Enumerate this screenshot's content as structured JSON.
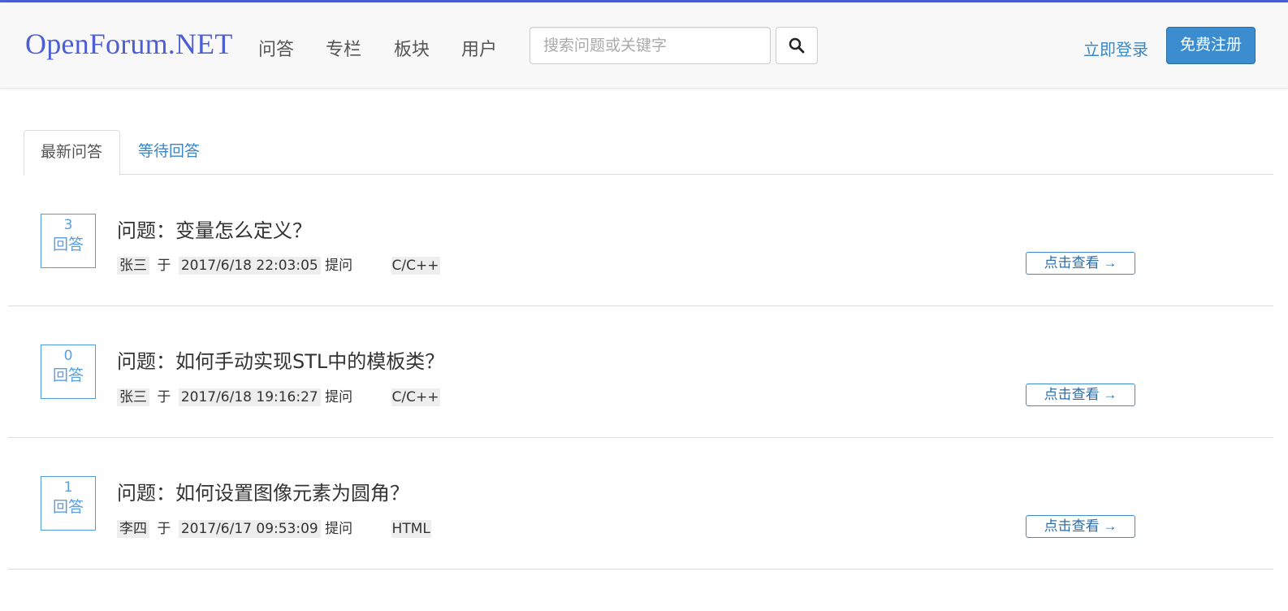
{
  "header": {
    "brand": "OpenForum.NET",
    "nav": [
      "问答",
      "专栏",
      "板块",
      "用户"
    ],
    "search": {
      "placeholder": "搜索问题或关键字",
      "value": ""
    },
    "login_label": "立即登录",
    "register_label": "免费注册"
  },
  "tabs": [
    {
      "label": "最新问答",
      "active": true
    },
    {
      "label": "等待回答",
      "active": false
    }
  ],
  "questions": [
    {
      "answer_count": "3",
      "answer_label": "回答",
      "title": "问题：变量怎么定义？",
      "author": "张三",
      "at_word": "于",
      "time": "2017/6/18 22:03:05",
      "action": "提问",
      "tag": "C/C++",
      "view_label": "点击查看 →"
    },
    {
      "answer_count": "0",
      "answer_label": "回答",
      "title": "问题：如何手动实现STL中的模板类？",
      "author": "张三",
      "at_word": "于",
      "time": "2017/6/18 19:16:27",
      "action": "提问",
      "tag": "C/C++",
      "view_label": "点击查看 →"
    },
    {
      "answer_count": "1",
      "answer_label": "回答",
      "title": "问题：如何设置图像元素为圆角？",
      "author": "李四",
      "at_word": "于",
      "time": "2017/6/17 09:53:09",
      "action": "提问",
      "tag": "HTML",
      "view_label": "点击查看 →"
    }
  ],
  "colors": {
    "brand": "#4d5fd4",
    "link": "#3a87c7",
    "primary_button": "#3c8dcf",
    "answer_box": "#5a9fe0"
  },
  "icons": {
    "search_button": "search-icon"
  }
}
